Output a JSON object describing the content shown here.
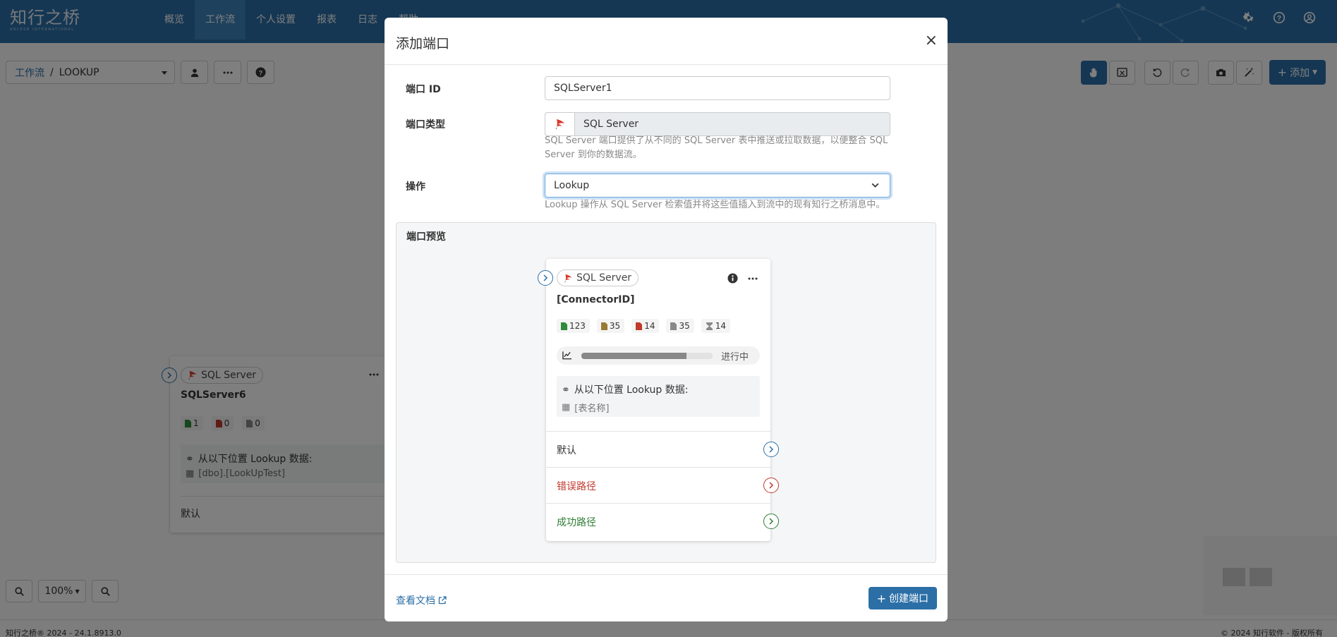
{
  "app": {
    "logo": "知行之桥",
    "logo_sub": "ARCESB INTERNATIONAL",
    "nav": [
      "概览",
      "工作流",
      "个人设置",
      "报表",
      "日志",
      "帮助"
    ],
    "active_nav": 1
  },
  "toolbar": {
    "breadcrumb_root": "工作流",
    "breadcrumb_sep": "/",
    "breadcrumb_current": "LOOKUP",
    "add_label": "添加"
  },
  "bg_card": {
    "type": "SQL Server",
    "name": "SQLServer6",
    "counts": [
      "1",
      "0",
      "0"
    ],
    "lookup_text": "从以下位置 Lookup 数据:",
    "table": "[dbo].[LookUpTest]",
    "route": "默认"
  },
  "zoom": {
    "level": "100%"
  },
  "footer": {
    "left": "知行之桥® 2024 - 24.1.8913.0",
    "right": "© 2024 知行软件 - 版权所有"
  },
  "modal": {
    "title": "添加端口",
    "close": "×",
    "id_label": "端口 ID",
    "id_value": "SQLServer1",
    "type_label": "端口类型",
    "type_value": "SQL Server",
    "type_help": "SQL Server 端口提供了从不同的 SQL Server 表中推送或拉取数据，以便整合 SQL Server 到你的数据流。",
    "op_label": "操作",
    "op_value": "Lookup",
    "op_help": "Lookup 操作从 SQL Server 检索值并将这些值插入到流中的现有知行之桥消息中。",
    "preview_label": "端口预览",
    "doc_link": "查看文档",
    "create_button": "创建端口"
  },
  "preview_card": {
    "type": "SQL Server",
    "name": "[ConnectorID]",
    "counts": [
      "123",
      "35",
      "14",
      "35",
      "14"
    ],
    "progress_fraction": 0.8,
    "progress_text": "进行中",
    "lookup_text": "从以下位置 Lookup 数据:",
    "table": "[表名称]",
    "routes": [
      "默认",
      "错误路径",
      "成功路径"
    ]
  },
  "colors": {
    "brand": "#2b6fa6",
    "error": "#c0392b",
    "success": "#2e7d32",
    "sql_red": "#d9372b"
  }
}
